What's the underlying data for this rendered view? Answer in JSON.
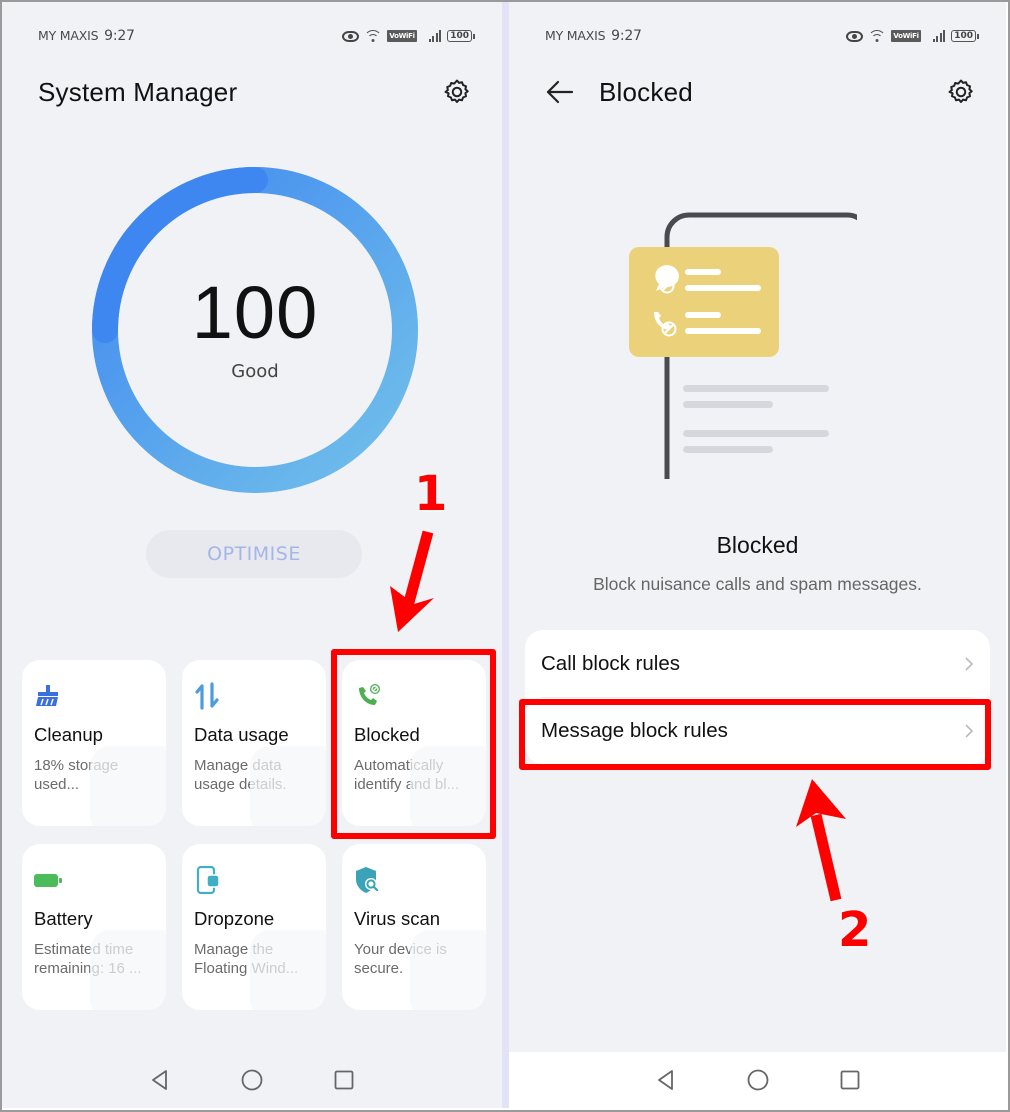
{
  "left_screen": {
    "status_bar": {
      "carrier": "MY MAXIS",
      "time": "9:27",
      "vowifi_label": "VoWiFi",
      "battery_level": "100",
      "icons": [
        "eye-comfort-icon",
        "wifi-icon",
        "vowifi-badge",
        "signal-icon",
        "battery-icon"
      ]
    },
    "header": {
      "title": "System Manager",
      "settings_icon": "gear-icon"
    },
    "score_ring": {
      "score": "100",
      "status": "Good",
      "progress_percent": 100,
      "colors": {
        "start": "#3f87f0",
        "end": "#72c1ea"
      }
    },
    "optimise_button": "OPTIMISE",
    "cards": [
      {
        "title": "Cleanup",
        "description": "18% storage used...",
        "icon": "broom-icon",
        "icon_color": "#3a6fe0"
      },
      {
        "title": "Data usage",
        "description": "Manage data usage details.",
        "icon": "data-transfer-arrows-icon",
        "icon_color": "#4a9be0"
      },
      {
        "title": "Blocked",
        "description": "Automatically identify and bl...",
        "icon": "blocked-call-icon",
        "icon_color": "#4caf50"
      },
      {
        "title": "Battery",
        "description": "Estimated time remaining: 16 ...",
        "icon": "battery-icon",
        "icon_color": "#4cbb5a"
      },
      {
        "title": "Dropzone",
        "description": "Manage the Floating Wind...",
        "icon": "floating-window-icon",
        "icon_color": "#3fb0c4"
      },
      {
        "title": "Virus scan",
        "description": "Your device is secure.",
        "icon": "shield-scan-icon",
        "icon_color": "#3aa3b8"
      }
    ],
    "nav_bar": [
      "back-icon",
      "home-icon",
      "recents-icon"
    ]
  },
  "right_screen": {
    "status_bar": {
      "carrier": "MY MAXIS",
      "time": "9:27",
      "vowifi_label": "VoWiFi",
      "battery_level": "100"
    },
    "header": {
      "title": "Blocked",
      "back_icon": "arrow-left-icon",
      "settings_icon": "gear-icon"
    },
    "illustration": {
      "accent_color": "#ebd27a"
    },
    "section_title": "Blocked",
    "section_subtitle": "Block nuisance calls and spam messages.",
    "list_items": [
      {
        "label": "Call block rules"
      },
      {
        "label": "Message block rules"
      }
    ],
    "nav_bar": [
      "back-icon",
      "home-icon",
      "recents-icon"
    ]
  },
  "annotations": {
    "color": "#ff0000",
    "step1": "1",
    "step2": "2"
  }
}
